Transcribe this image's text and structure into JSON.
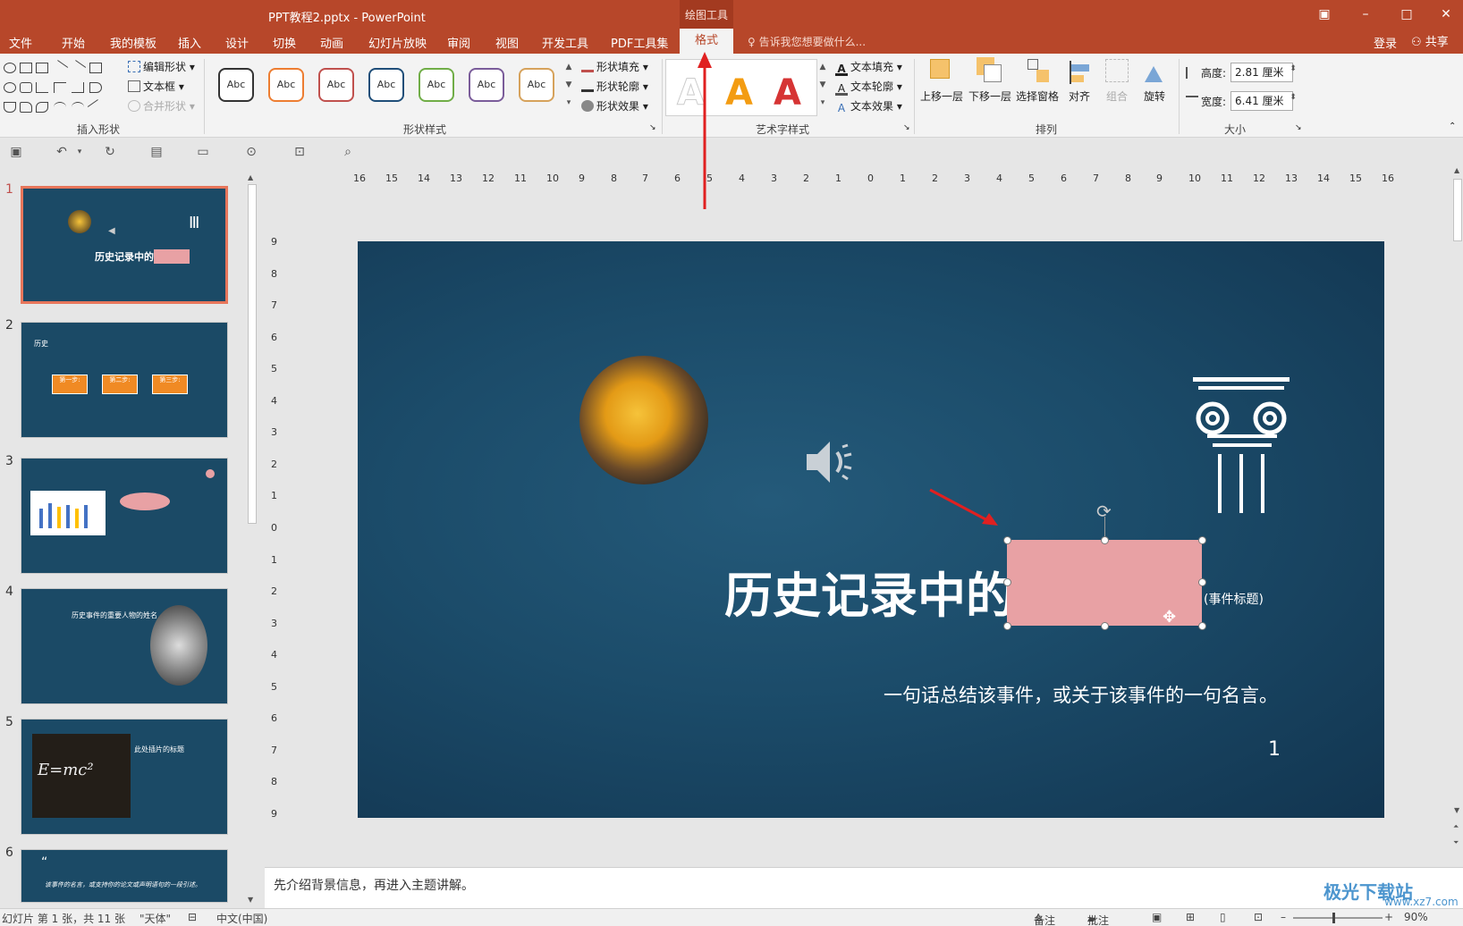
{
  "window": {
    "title": "PPT教程2.pptx - PowerPoint",
    "context_tab_group": "绘图工具",
    "controls": [
      "restore",
      "minimize",
      "maximize",
      "close"
    ]
  },
  "tabs": [
    "文件",
    "开始",
    "我的模板",
    "插入",
    "设计",
    "切换",
    "动画",
    "幻灯片放映",
    "审阅",
    "视图",
    "开发工具",
    "PDF工具集",
    "格式"
  ],
  "active_tab": "格式",
  "tell_me": "告诉我您想要做什么...",
  "account": {
    "login": "登录",
    "share": "共享"
  },
  "ribbon": {
    "insert_shapes": {
      "label": "插入形状",
      "edit_shape": "编辑形状",
      "text_box": "文本框",
      "merge_shapes": "合并形状"
    },
    "shape_styles": {
      "label": "形状样式",
      "style_sample": "Abc",
      "style_colors": [
        "#333333",
        "#ed7d31",
        "#c0504d",
        "#1f4e79",
        "#70ad47",
        "#7a5c9a",
        "#d6a25b"
      ],
      "shape_fill": "形状填充",
      "shape_outline": "形状轮廓",
      "shape_effects": "形状效果"
    },
    "wordart": {
      "label": "艺术字样式",
      "samples": [
        "A",
        "A",
        "A"
      ],
      "sample_colors": [
        "#e8e8e8",
        "#f39c12",
        "#d63434"
      ],
      "text_fill": "文本填充",
      "text_outline": "文本轮廓",
      "text_effects": "文本效果"
    },
    "arrange": {
      "label": "排列",
      "bring_forward": "上移一层",
      "send_backward": "下移一层",
      "selection_pane": "选择窗格",
      "align": "对齐",
      "group": "组合",
      "rotate": "旋转"
    },
    "size": {
      "label": "大小",
      "height_label": "高度:",
      "height_value": "2.81 厘米",
      "width_label": "宽度:",
      "width_value": "6.41 厘米"
    }
  },
  "rulers": {
    "horizontal": [
      "16",
      "15",
      "14",
      "13",
      "12",
      "11",
      "10",
      "9",
      "8",
      "7",
      "6",
      "5",
      "4",
      "3",
      "2",
      "1",
      "0",
      "1",
      "2",
      "3",
      "4",
      "5",
      "6",
      "7",
      "8",
      "9",
      "10",
      "11",
      "12",
      "13",
      "14",
      "15",
      "16"
    ],
    "vertical": [
      "9",
      "8",
      "7",
      "6",
      "5",
      "4",
      "3",
      "2",
      "1",
      "0",
      "1",
      "2",
      "3",
      "4",
      "5",
      "6",
      "7",
      "8",
      "9"
    ]
  },
  "thumbnails": [
    {
      "num": "1",
      "title": "历史记录中的"
    },
    {
      "num": "2",
      "title": "历史",
      "steps": [
        "第一步:",
        "第二步:",
        "第三步:"
      ]
    },
    {
      "num": "3",
      "title": ""
    },
    {
      "num": "4",
      "title": "历史事件的重要人物的姓名"
    },
    {
      "num": "5",
      "title": "此处插片的标题",
      "formula": "E=mc²"
    },
    {
      "num": "6",
      "title": "该事件的名言，或支持你的论文或声明语句的一段引述。",
      "mark": "“"
    }
  ],
  "slide": {
    "title": "历史记录中的",
    "event_label": "(事件标题)",
    "quote": "一句话总结该事件，或关于该事件的一句名言。",
    "page_number": "1"
  },
  "notes": "先介绍背景信息，再进入主题讲解。",
  "status": {
    "slide_info": "幻灯片 第 1 张，共 11 张",
    "theme": "\"天体\"",
    "language": "中文(中国)",
    "notes_btn": "备注",
    "comments_btn": "批注",
    "zoom": "90%"
  },
  "watermark": {
    "main": "极光下载站",
    "sub": "www.xz7.com"
  }
}
